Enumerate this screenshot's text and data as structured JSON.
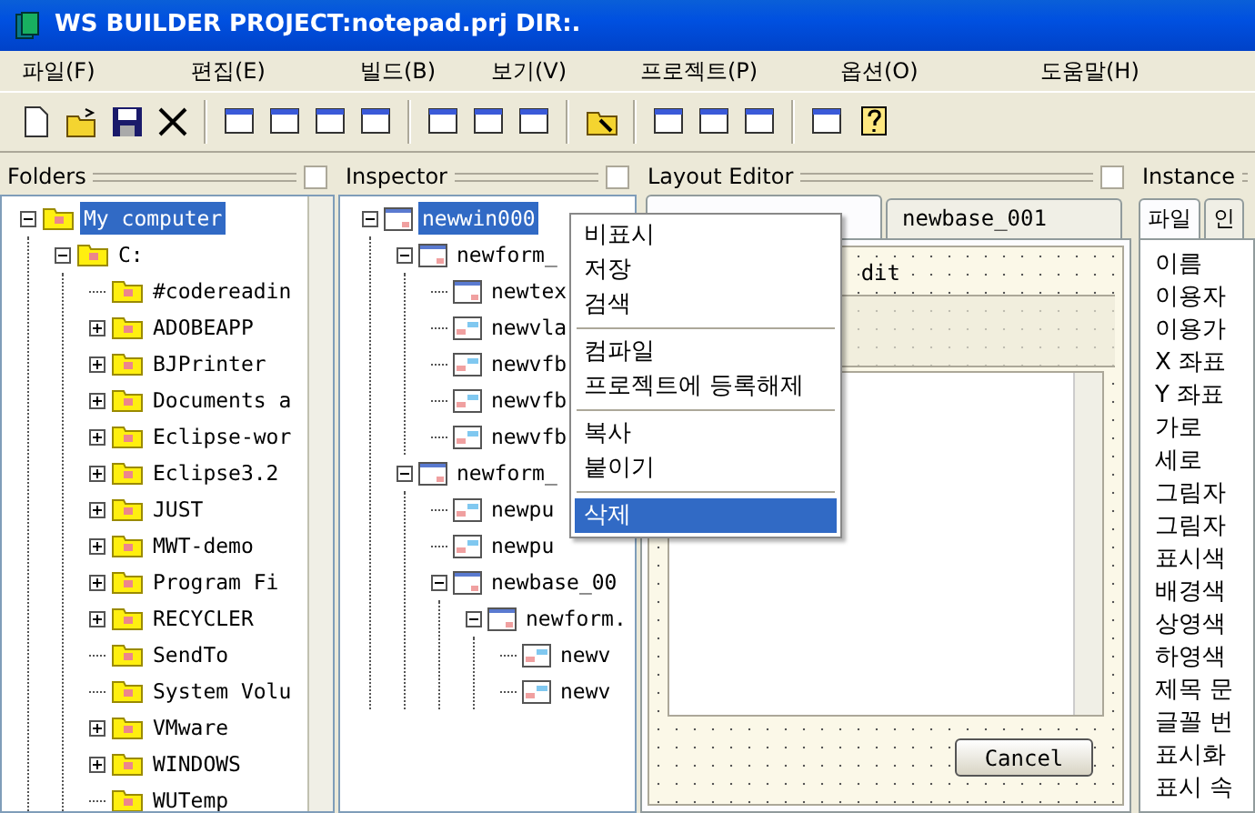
{
  "window": {
    "title": "WS BUILDER PROJECT:notepad.prj DIR:."
  },
  "menu": [
    "파일(F)",
    "편집(E)",
    "빌드(B)",
    "보기(V)",
    "프로젝트(P)",
    "옵션(O)",
    "도움말(H)"
  ],
  "folders": {
    "title": "Folders",
    "tree": [
      {
        "label": "My computer",
        "selected": true,
        "expanded": true,
        "children": [
          {
            "label": "C:",
            "selected": false,
            "expanded": true,
            "children": [
              {
                "label": "#codereadin",
                "selected": false,
                "collapsed": false
              },
              {
                "label": "ADOBEAPP",
                "selected": false,
                "collapsed": true
              },
              {
                "label": "BJPrinter",
                "selected": false,
                "collapsed": true
              },
              {
                "label": "Documents a",
                "selected": false,
                "collapsed": true
              },
              {
                "label": "Eclipse-wor",
                "selected": false,
                "collapsed": true
              },
              {
                "label": "Eclipse3.2",
                "selected": false,
                "collapsed": true
              },
              {
                "label": "JUST",
                "selected": false,
                "collapsed": true
              },
              {
                "label": "MWT-demo",
                "selected": false,
                "collapsed": true
              },
              {
                "label": "Program Fi",
                "selected": false,
                "collapsed": true
              },
              {
                "label": "RECYCLER",
                "selected": false,
                "collapsed": true
              },
              {
                "label": "SendTo",
                "selected": false,
                "collapsed": false
              },
              {
                "label": "System Volu",
                "selected": false,
                "collapsed": false
              },
              {
                "label": "VMware",
                "selected": false,
                "collapsed": true
              },
              {
                "label": "WINDOWS",
                "selected": false,
                "collapsed": true
              },
              {
                "label": "WUTemp",
                "selected": false,
                "collapsed": false
              }
            ]
          }
        ]
      }
    ]
  },
  "inspector": {
    "title": "Inspector",
    "tree": [
      {
        "label": "newwin000",
        "kind": "window",
        "selected": true,
        "expanded": true,
        "children": [
          {
            "label": "newform_",
            "kind": "window",
            "selected": false,
            "expanded": true,
            "children": [
              {
                "label": "newtex",
                "kind": "window",
                "selected": false
              },
              {
                "label": "newvla",
                "kind": "control",
                "selected": false
              },
              {
                "label": "newvfb",
                "kind": "control",
                "selected": false
              },
              {
                "label": "newvfb",
                "kind": "control",
                "selected": false
              },
              {
                "label": "newvfb",
                "kind": "control",
                "selected": false
              }
            ]
          },
          {
            "label": "newform_",
            "kind": "window",
            "selected": false,
            "expanded": true,
            "children": [
              {
                "label": "newpu",
                "kind": "control",
                "selected": false
              },
              {
                "label": "newpu",
                "kind": "control",
                "selected": false
              },
              {
                "label": "newbase_00",
                "kind": "window",
                "selected": false,
                "expanded": true,
                "children": [
                  {
                    "label": "newform.",
                    "kind": "window",
                    "selected": false,
                    "expanded": true,
                    "children": [
                      {
                        "label": "newv",
                        "kind": "control",
                        "selected": false
                      },
                      {
                        "label": "newv",
                        "kind": "control",
                        "selected": false
                      }
                    ]
                  }
                ]
              }
            ]
          }
        ]
      }
    ]
  },
  "layout_editor": {
    "title": "Layout Editor",
    "tabs": [
      {
        "selected": true
      },
      {
        "label": "newbase_001",
        "selected": false
      }
    ],
    "edit_label": "dit",
    "cancel_button": "Cancel"
  },
  "instance": {
    "title": "Instance",
    "tabs": [
      {
        "label": "파일",
        "selected": true
      },
      {
        "label": "인",
        "selected": false
      }
    ],
    "properties": [
      "이름",
      "이용자",
      "이용가",
      "X 좌표",
      "Y 좌표",
      "가로",
      "세로",
      "그림자",
      "그림자",
      "표시색",
      "배경색",
      "상영색",
      "하영색",
      "제목 문",
      "글꼴 번",
      "표시화",
      "표시 속"
    ]
  },
  "context_menu": [
    {
      "label": "비표시",
      "selected": false
    },
    {
      "label": "저장",
      "selected": false
    },
    {
      "label": "검색",
      "selected": false
    },
    {
      "kind": "separator"
    },
    {
      "label": "컴파일",
      "selected": false
    },
    {
      "label": "프로젝트에 등록해제",
      "selected": false
    },
    {
      "kind": "separator"
    },
    {
      "label": "복사",
      "selected": false
    },
    {
      "label": "붙이기",
      "selected": false
    },
    {
      "kind": "separator"
    },
    {
      "label": "삭제",
      "selected": true
    }
  ]
}
